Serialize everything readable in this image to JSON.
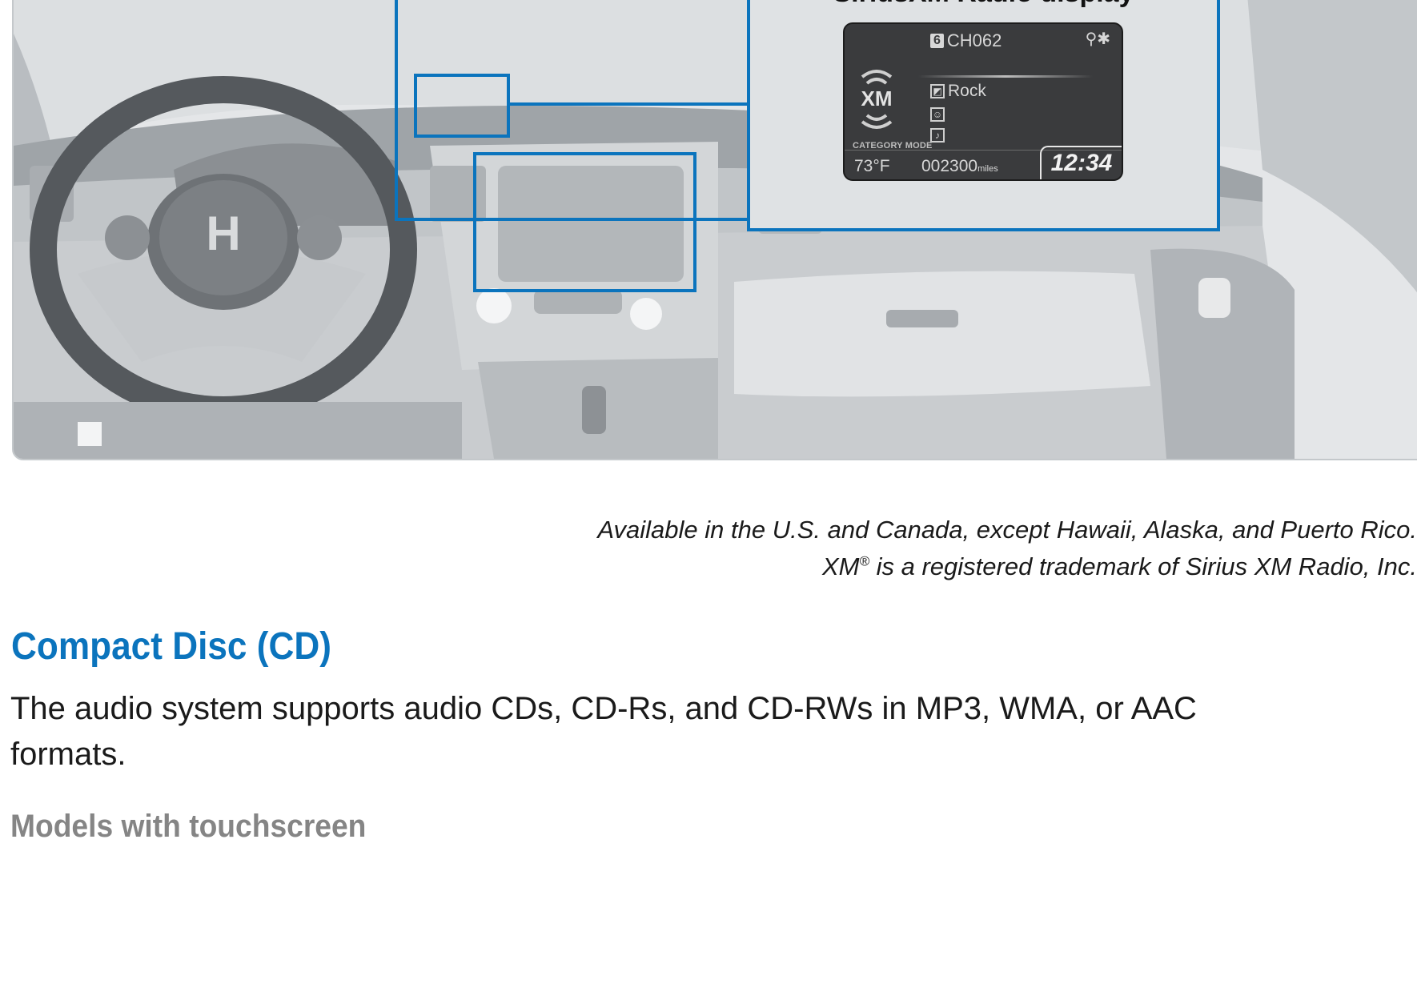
{
  "figure": {
    "callout_title": "SiriusXM Radio display",
    "display": {
      "preset": "6",
      "channel": "CH062",
      "genre": "Rock",
      "logo": "XM",
      "mode": "CATEGORY MODE",
      "temperature": "73°F",
      "odometer_value": "002300",
      "odometer_unit": "miles",
      "clock": "12:34",
      "icons": [
        "usb-icon",
        "bluetooth-icon",
        "genre-icon",
        "artist-icon",
        "song-icon"
      ]
    },
    "colors": {
      "callout": "#0b74bd",
      "display_bg": "#3a3b3d"
    }
  },
  "notes": {
    "availability": "Available in the U.S. and Canada, except Hawaii, Alaska, and Puerto Rico.",
    "trademark_prefix": "XM",
    "trademark_mark": "®",
    "trademark_suffix": " is a registered trademark of Sirius XM Radio, Inc."
  },
  "section": {
    "title": "Compact Disc (CD)",
    "body": "The audio system supports audio CDs, CD-Rs, and CD-RWs in MP3, WMA, or AAC formats.",
    "subtitle": "Models with touchscreen"
  }
}
